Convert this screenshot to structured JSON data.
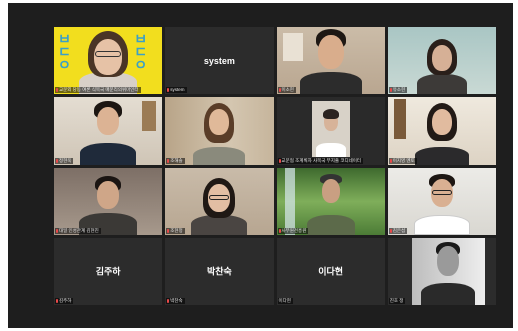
{
  "colors": {
    "background": "#1e1e1e",
    "tile": "#2b2b2b",
    "label_text": "#e8e8e8",
    "muted_mic": "#e84a4a",
    "highlight": "#f5e000"
  },
  "participants": [
    {
      "id": "p1",
      "label": "교문외 당동 여론 식목국 매문리의위마인터",
      "mic": "mic-muted-icon"
    },
    {
      "id": "p2",
      "label": "system",
      "big_name": "system",
      "mic": "mic-muted-icon"
    },
    {
      "id": "p3",
      "label": "이소현",
      "mic": "mic-muted-icon"
    },
    {
      "id": "p4",
      "label": "유소현",
      "mic": "mic-muted-icon"
    },
    {
      "id": "p5",
      "label": "정현욱",
      "mic": "mic-muted-icon"
    },
    {
      "id": "p6",
      "label": "조해솔",
      "mic": "mic-muted-icon"
    },
    {
      "id": "p7",
      "label": "교문협 조계획자 사목국 부지출 코디네이터",
      "mic": "mic-muted-icon"
    },
    {
      "id": "p8",
      "label": "이지영 멘토",
      "mic": "mic-muted-icon"
    },
    {
      "id": "p9",
      "label": "대일 인성관계 김현진",
      "mic": "mic-muted-icon"
    },
    {
      "id": "p10",
      "label": "조현정",
      "mic": "mic-muted-icon"
    },
    {
      "id": "p11",
      "label": "사무원천흥원",
      "mic": "mic-muted-icon"
    },
    {
      "id": "p12",
      "label": "김은섭",
      "mic": "mic-muted-icon"
    },
    {
      "id": "p13",
      "label": "김주하",
      "big_name": "김주하",
      "mic": "mic-muted-icon"
    },
    {
      "id": "p14",
      "label": "박찬숙",
      "big_name": "박찬숙",
      "mic": "mic-muted-icon"
    },
    {
      "id": "p15",
      "label": "이다현",
      "big_name": "이다현",
      "mic": ""
    },
    {
      "id": "p16",
      "label": "진호 정",
      "mic": ""
    }
  ]
}
